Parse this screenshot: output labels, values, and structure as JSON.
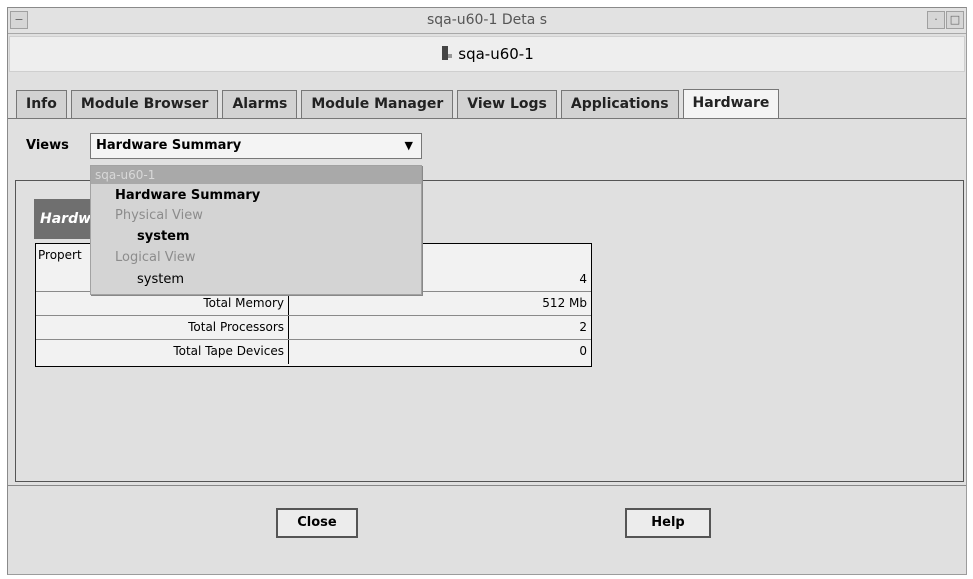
{
  "window": {
    "title": "sqa-u60-1 Deta s",
    "host_label": "sqa-u60-1"
  },
  "tabs": [
    {
      "label": "Info",
      "active": false
    },
    {
      "label": "Module Browser",
      "active": false
    },
    {
      "label": "Alarms",
      "active": false
    },
    {
      "label": "Module Manager",
      "active": false
    },
    {
      "label": "View Logs",
      "active": false
    },
    {
      "label": "Applications",
      "active": false
    },
    {
      "label": "Hardware",
      "active": true
    }
  ],
  "views": {
    "label": "Views",
    "selected": "Hardware Summary"
  },
  "dropdown": {
    "host": "sqa-u60-1",
    "items": [
      {
        "label": "Hardware Summary",
        "enabled": true
      },
      {
        "label": "Physical View",
        "enabled": false
      },
      {
        "label": "system",
        "enabled": true
      },
      {
        "label": "Logical View",
        "enabled": false
      },
      {
        "label": "system",
        "enabled": true
      }
    ]
  },
  "section": {
    "title": "Hardw",
    "column_header": "Propert"
  },
  "table": {
    "rows": [
      {
        "property": "",
        "value": "4"
      },
      {
        "property": "Total Memory",
        "value": "512 Mb"
      },
      {
        "property": "Total Processors",
        "value": "2"
      },
      {
        "property": "Total Tape Devices",
        "value": "0"
      }
    ]
  },
  "buttons": {
    "close": "Close",
    "help": "Help"
  }
}
